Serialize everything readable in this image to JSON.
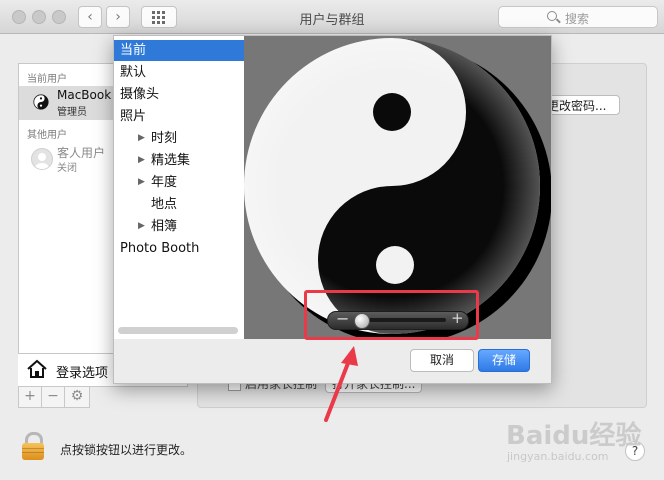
{
  "window": {
    "title": "用户与群组",
    "search_placeholder": "搜索"
  },
  "users": {
    "current_header": "当前用户",
    "current_name": "MacBook",
    "current_role": "管理员",
    "other_header": "其他用户",
    "guest_name": "客人用户",
    "guest_status": "关闭",
    "login_options": "登录选项"
  },
  "right": {
    "change_password": "更改密码...",
    "parental_checkbox": "启用家长控制",
    "parental_button": "打开家长控制..."
  },
  "footer": {
    "lock_text": "点按锁按钮以进行更改。",
    "help": "?"
  },
  "dialog": {
    "sources": [
      {
        "label": "当前",
        "selected": true,
        "indent": false,
        "expandable": false
      },
      {
        "label": "默认",
        "selected": false,
        "indent": false,
        "expandable": false
      },
      {
        "label": "摄像头",
        "selected": false,
        "indent": false,
        "expandable": false
      },
      {
        "label": "照片",
        "selected": false,
        "indent": false,
        "expandable": false
      },
      {
        "label": "时刻",
        "selected": false,
        "indent": true,
        "expandable": true
      },
      {
        "label": "精选集",
        "selected": false,
        "indent": true,
        "expandable": true
      },
      {
        "label": "年度",
        "selected": false,
        "indent": true,
        "expandable": true
      },
      {
        "label": "地点",
        "selected": false,
        "indent": true,
        "expandable": false
      },
      {
        "label": "相簿",
        "selected": false,
        "indent": true,
        "expandable": true
      },
      {
        "label": "Photo Booth",
        "selected": false,
        "indent": false,
        "expandable": false
      }
    ],
    "zoom": {
      "minus": "−",
      "plus": "+",
      "level": 0.0
    },
    "cancel_label": "取消",
    "save_label": "存储"
  },
  "colors": {
    "selection": "#2f7ad9",
    "highlight_box": "#ea3a4a"
  },
  "watermark": {
    "main": "Baidu经验",
    "sub": "jingyan.baidu.com"
  }
}
